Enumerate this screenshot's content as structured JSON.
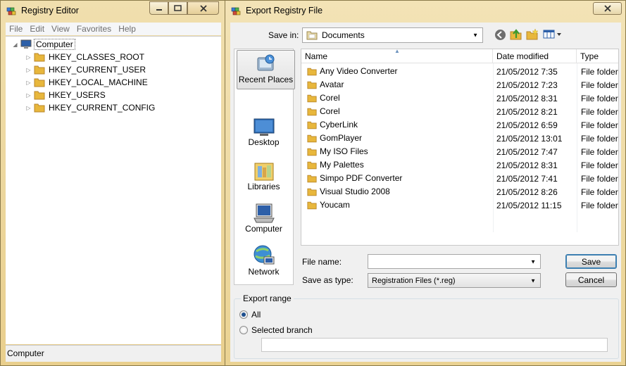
{
  "registry_editor": {
    "title": "Registry Editor",
    "menu": [
      "File",
      "Edit",
      "View",
      "Favorites",
      "Help"
    ],
    "tree": {
      "root": "Computer",
      "hives": [
        "HKEY_CLASSES_ROOT",
        "HKEY_CURRENT_USER",
        "HKEY_LOCAL_MACHINE",
        "HKEY_USERS",
        "HKEY_CURRENT_CONFIG"
      ]
    },
    "status": "Computer"
  },
  "export_dialog": {
    "title": "Export Registry File",
    "save_in_label": "Save in:",
    "save_in_value": "Documents",
    "places": [
      "Recent Places",
      "Desktop",
      "Libraries",
      "Computer",
      "Network"
    ],
    "columns": {
      "name": "Name",
      "date": "Date modified",
      "type": "Type"
    },
    "files": [
      {
        "name": "Any Video Converter",
        "date": "21/05/2012 7:35",
        "type": "File folder"
      },
      {
        "name": "Avatar",
        "date": "21/05/2012 7:23",
        "type": "File folder"
      },
      {
        "name": "Corel",
        "date": "21/05/2012 8:31",
        "type": "File folder"
      },
      {
        "name": "Corel",
        "date": "21/05/2012 8:21",
        "type": "File folder"
      },
      {
        "name": "CyberLink",
        "date": "21/05/2012 6:59",
        "type": "File folder"
      },
      {
        "name": "GomPlayer",
        "date": "21/05/2012 13:01",
        "type": "File folder"
      },
      {
        "name": "My ISO Files",
        "date": "21/05/2012 7:47",
        "type": "File folder"
      },
      {
        "name": "My Palettes",
        "date": "21/05/2012 8:31",
        "type": "File folder"
      },
      {
        "name": "Simpo PDF Converter",
        "date": "21/05/2012 7:41",
        "type": "File folder"
      },
      {
        "name": "Visual Studio 2008",
        "date": "21/05/2012 8:26",
        "type": "File folder"
      },
      {
        "name": "Youcam",
        "date": "21/05/2012 11:15",
        "type": "File folder"
      }
    ],
    "file_name_label": "File name:",
    "file_name_value": "",
    "save_as_type_label": "Save as type:",
    "save_as_type_value": "Registration Files (*.reg)",
    "save_button": "Save",
    "cancel_button": "Cancel",
    "export_range": {
      "title": "Export range",
      "all_label": "All",
      "selected_branch_label": "Selected branch",
      "selected": "all",
      "branch_value": ""
    }
  },
  "colors": {
    "titlebar": "#ecd699",
    "folder": "#e8b73c",
    "accent": "#3c7fb1"
  }
}
